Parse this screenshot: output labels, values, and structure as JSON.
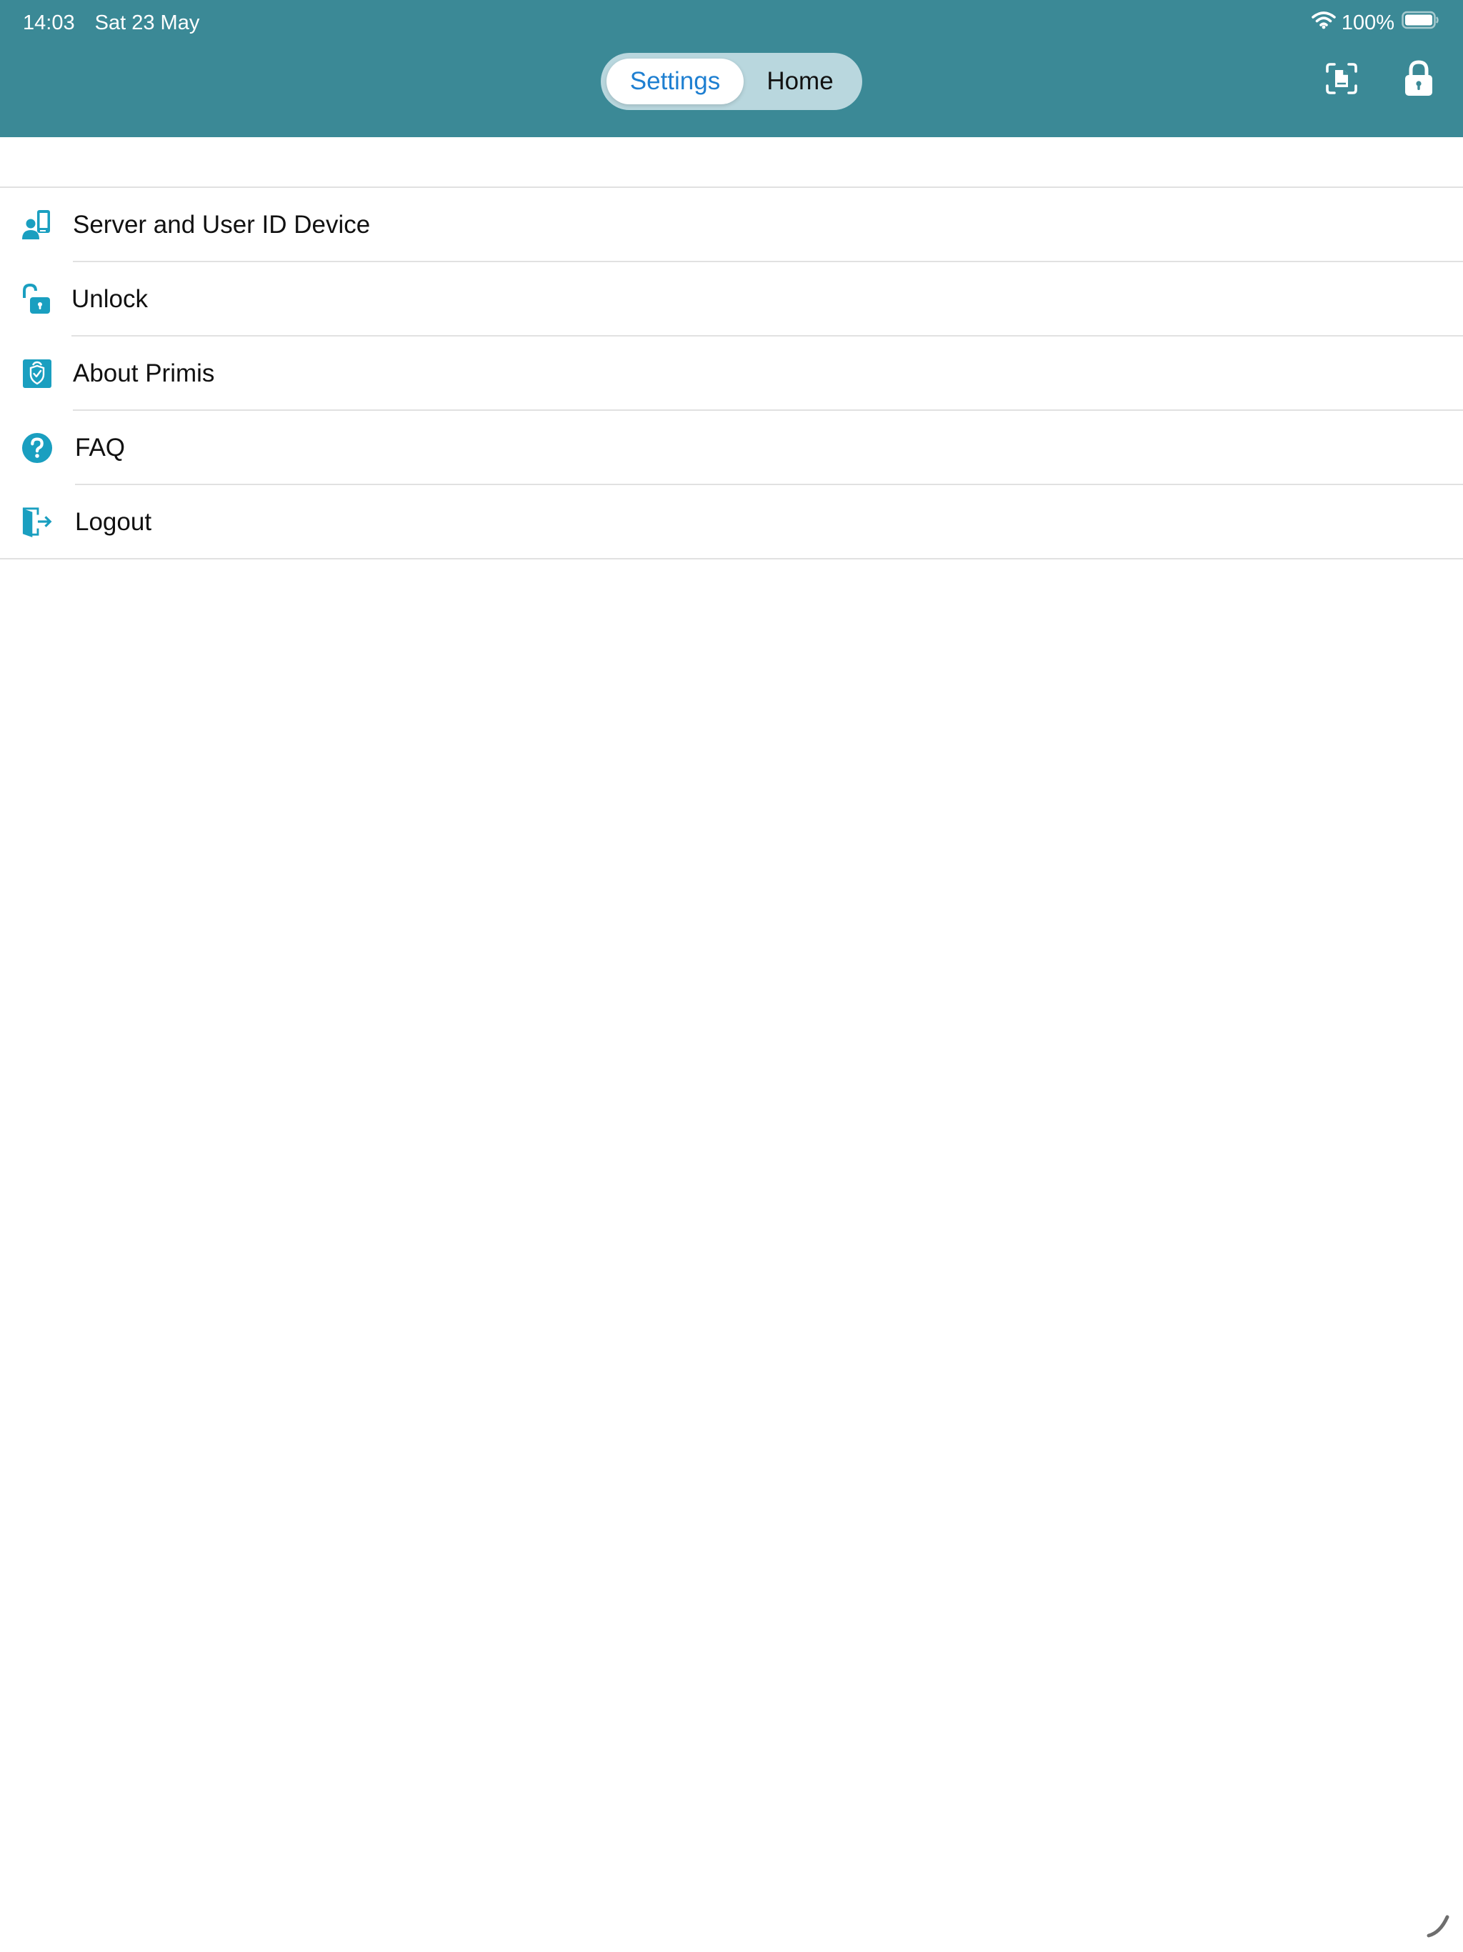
{
  "status_bar": {
    "time": "14:03",
    "date": "Sat 23 May",
    "battery": "100%",
    "wifi_icon": "wifi-icon",
    "battery_icon": "battery-icon"
  },
  "header": {
    "background_color": "#3b8996",
    "segments": [
      {
        "label": "Settings",
        "selected": true
      },
      {
        "label": "Home",
        "selected": false
      }
    ],
    "actions": [
      {
        "icon": "document-scan-icon"
      },
      {
        "icon": "lock-icon"
      }
    ]
  },
  "menu": {
    "accent_color": "#1a9fc0",
    "items": [
      {
        "label": "Server and User ID Device",
        "icon": "user-device-icon"
      },
      {
        "label": "Unlock",
        "icon": "unlock-icon"
      },
      {
        "label": "About Primis",
        "icon": "shield-icon"
      },
      {
        "label": "FAQ",
        "icon": "question-circle-icon"
      },
      {
        "label": "Logout",
        "icon": "logout-door-icon"
      }
    ]
  }
}
